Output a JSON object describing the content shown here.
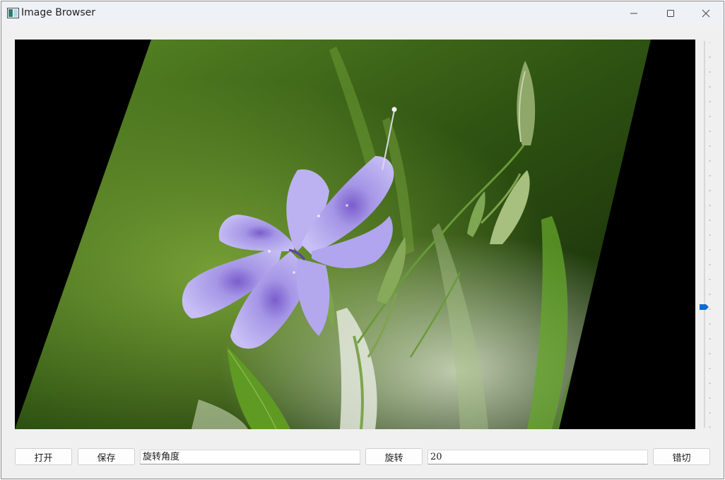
{
  "window": {
    "title": "Image Browser"
  },
  "toolbar": {
    "open_label": "打开",
    "save_label": "保存",
    "angle_field_value": "旋转角度",
    "rotate_label": "旋转",
    "shear_field_value": "20",
    "shear_label": "错切"
  },
  "viewer": {
    "image_description_icon": "flower-photo",
    "transform": "sheared"
  },
  "slider": {
    "orientation": "vertical",
    "level": 0.68
  },
  "colors": {
    "accent": "#0a6cd1",
    "flower": "#a99ce8",
    "foliage": "#4b7a1e"
  }
}
